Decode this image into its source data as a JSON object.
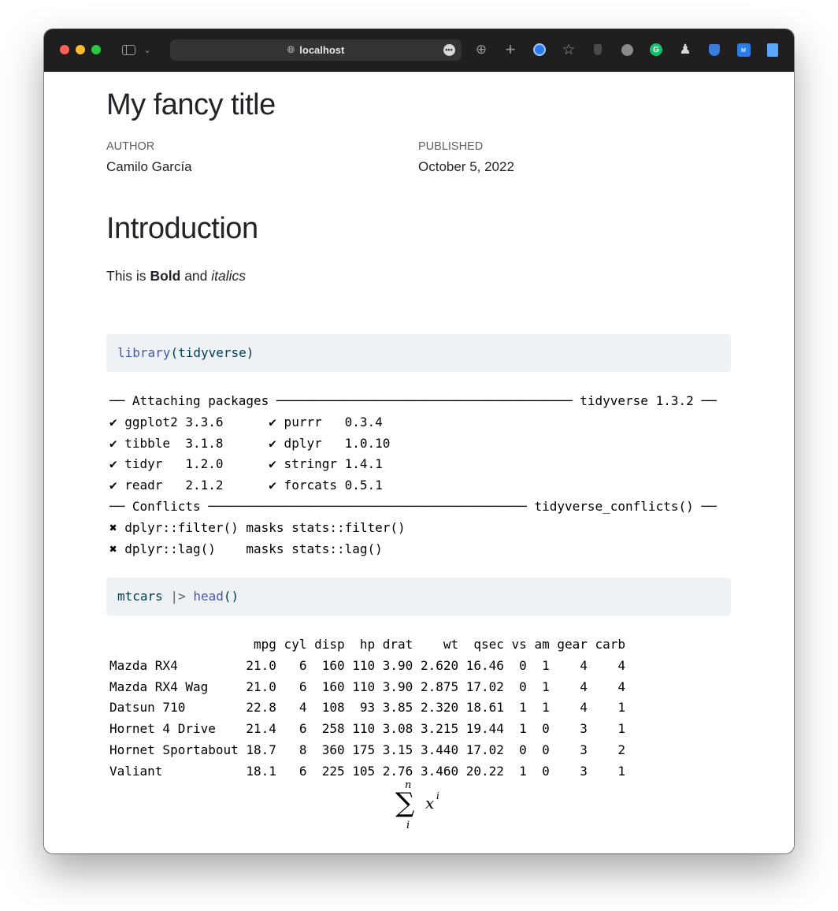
{
  "browser": {
    "url": "localhost"
  },
  "page": {
    "title": "My fancy title",
    "author_label": "AUTHOR",
    "author": "Camilo García",
    "published_label": "PUBLISHED",
    "published": "October 5, 2022",
    "section_heading": "Introduction",
    "intro": {
      "prefix": "This is ",
      "bold": "Bold",
      "middle": " and ",
      "italic": "italics"
    },
    "code_block_1": {
      "fn": "library",
      "open": "(",
      "arg": "tidyverse",
      "close": ")"
    },
    "output_1": [
      "── Attaching packages ─────────────────────────────────────── tidyverse 1.3.2 ──",
      "✔ ggplot2 3.3.6      ✔ purrr   0.3.4",
      "✔ tibble  3.1.8      ✔ dplyr   1.0.10",
      "✔ tidyr   1.2.0      ✔ stringr 1.4.1",
      "✔ readr   2.1.2      ✔ forcats 0.5.1",
      "── Conflicts ────────────────────────────────────────── tidyverse_conflicts() ──",
      "✖ dplyr::filter() masks stats::filter()",
      "✖ dplyr::lag()    masks stats::lag()"
    ],
    "code_block_2": {
      "obj": "mtcars",
      "pipe": " |> ",
      "fn": "head",
      "parens": "()"
    },
    "output_2": [
      "                   mpg cyl disp  hp drat    wt  qsec vs am gear carb",
      "Mazda RX4         21.0   6  160 110 3.90 2.620 16.46  0  1    4    4",
      "Mazda RX4 Wag     21.0   6  160 110 3.90 2.875 17.02  0  1    4    4",
      "Datsun 710        22.8   4  108  93 3.85 2.320 18.61  1  1    4    1",
      "Hornet 4 Drive    21.4   6  258 110 3.08 3.215 19.44  1  0    3    1",
      "Hornet Sportabout 18.7   8  360 175 3.15 3.440 17.02  0  0    3    2",
      "Valiant           18.1   6  225 105 2.76 3.460 20.22  1  0    3    1"
    ],
    "math": {
      "operator": "∑",
      "upper": "n",
      "lower": "i",
      "base": "x",
      "exponent": "i"
    }
  }
}
